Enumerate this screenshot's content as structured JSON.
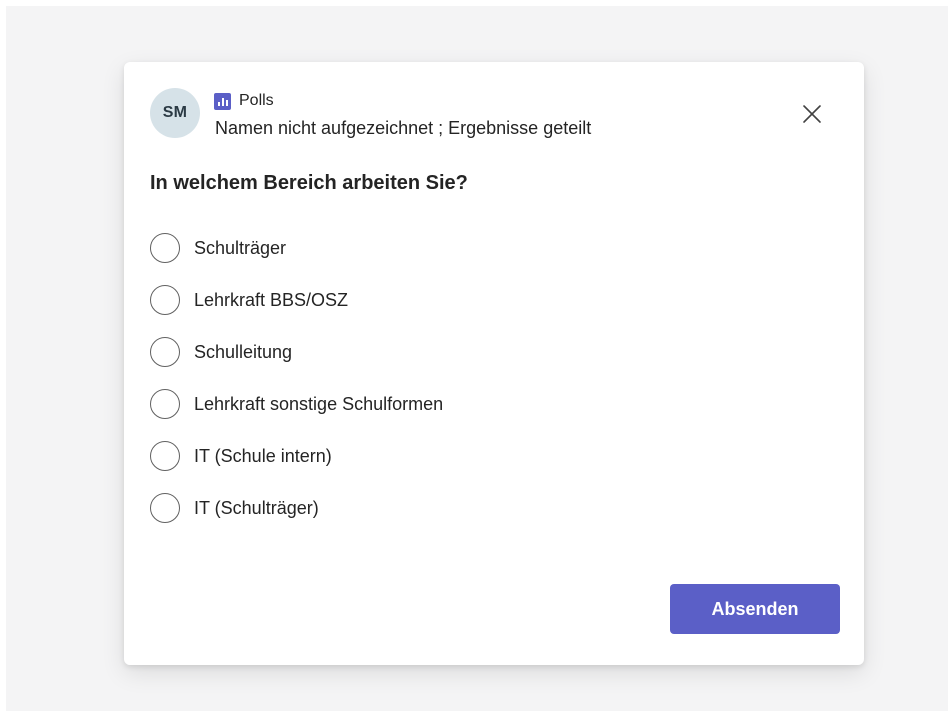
{
  "avatar": {
    "initials": "SM",
    "background": "#d6e2e8"
  },
  "app": {
    "name": "Polls",
    "icon": "poll-chart-icon",
    "color": "#5b5fc7"
  },
  "subtitle": "Namen nicht aufgezeichnet ; Ergebnisse geteilt",
  "close": {
    "icon": "close-icon"
  },
  "question": "In welchem Bereich arbeiten Sie?",
  "options": [
    {
      "label": "Schulträger",
      "selected": false
    },
    {
      "label": "Lehrkraft BBS/OSZ",
      "selected": false
    },
    {
      "label": "Schulleitung",
      "selected": false
    },
    {
      "label": "Lehrkraft sonstige Schulformen",
      "selected": false
    },
    {
      "label": "IT (Schule intern)",
      "selected": false
    },
    {
      "label": "IT (Schulträger)",
      "selected": false
    }
  ],
  "submit": {
    "label": "Absenden",
    "color": "#5b5fc7"
  }
}
